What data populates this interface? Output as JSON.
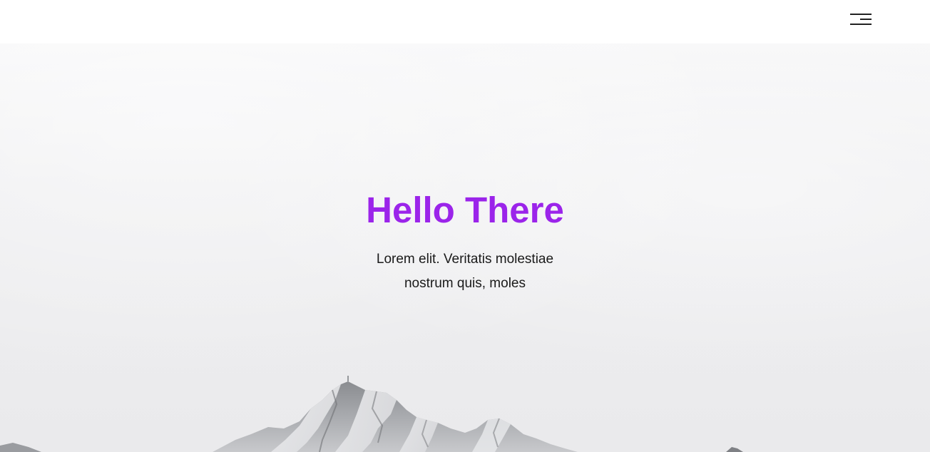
{
  "header": {
    "menu_icon": "hamburger-menu-icon"
  },
  "hero": {
    "title": "Hello There",
    "subtitle": "Lorem elit. Veritatis molestiae nostrum quis, moles",
    "background": "snowy-mountain-peak"
  },
  "colors": {
    "accent": "#9b24ea",
    "text": "#1a1a1a",
    "header_bg": "#ffffff"
  }
}
